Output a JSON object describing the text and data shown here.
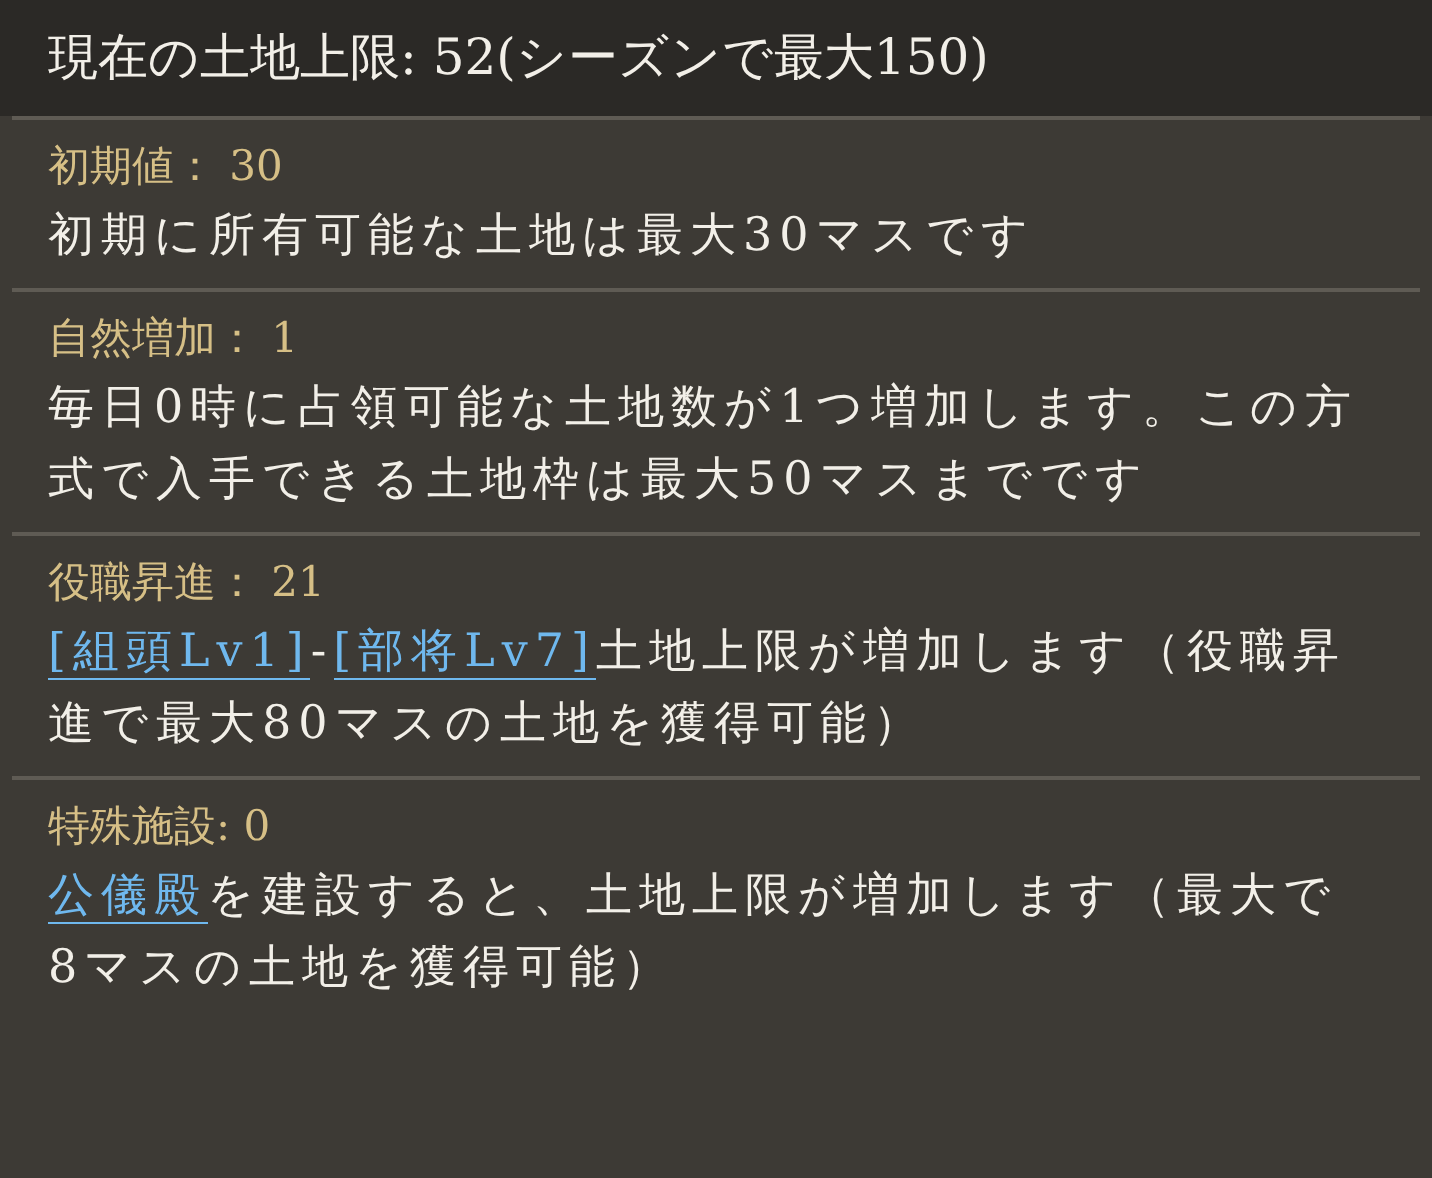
{
  "title": "現在の土地上限: 52(シーズンで最大150)",
  "sections": [
    {
      "label": "初期値：",
      "value": "30",
      "description": [
        {
          "text": "初期に所有可能な土地は最大30マスです",
          "link": false
        }
      ]
    },
    {
      "label": "自然増加：",
      "value": "1",
      "description": [
        {
          "text": "毎日0時に占領可能な土地数が1つ増加します。この方式で入手できる土地枠は最大50マスまでです",
          "link": false
        }
      ]
    },
    {
      "label": "役職昇進：",
      "value": "21",
      "description": [
        {
          "text": "[組頭Lv1]",
          "link": true
        },
        {
          "text": "-",
          "link": false
        },
        {
          "text": "[部将Lv7]",
          "link": true
        },
        {
          "text": "土地上限が増加します（役職昇進で最大80マスの土地を獲得可能）",
          "link": false
        }
      ]
    },
    {
      "label": "特殊施設:",
      "value": "0",
      "description": [
        {
          "text": "公儀殿",
          "link": true
        },
        {
          "text": "を建設すると、土地上限が増加します（最大で8マスの土地を獲得可能）",
          "link": false
        }
      ]
    }
  ]
}
